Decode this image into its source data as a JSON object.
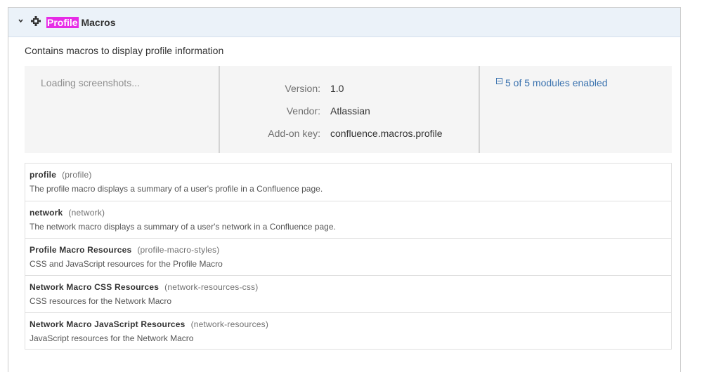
{
  "header": {
    "title_highlight": "Profile",
    "title_rest": " Macros",
    "highlight_color": "#e62be6",
    "background": "#ebf2f9",
    "expand_icon": "chevron-down-icon",
    "plugin_icon": "plugin-puzzle-icon"
  },
  "description": "Contains macros to display profile information",
  "screenshots": {
    "loading_text": "Loading screenshots..."
  },
  "details": {
    "version_label": "Version:",
    "version": "1.0",
    "vendor_label": "Vendor:",
    "vendor": "Atlassian",
    "key_label": "Add-on key:",
    "key": "confluence.macros.profile"
  },
  "modules_summary": {
    "text": "5 of 5 modules enabled",
    "icon": "collapse-minus-icon",
    "link_color": "#3b73af"
  },
  "modules": [
    {
      "name": "profile",
      "key": "(profile)",
      "description": "The profile macro displays a summary of a user's profile in a Confluence page."
    },
    {
      "name": "network",
      "key": "(network)",
      "description": "The network macro displays a summary of a user's network in a Confluence page."
    },
    {
      "name": "Profile Macro Resources",
      "key": "(profile-macro-styles)",
      "description": "CSS and JavaScript resources for the Profile Macro"
    },
    {
      "name": "Network Macro CSS Resources",
      "key": "(network-resources-css)",
      "description": "CSS resources for the Network Macro"
    },
    {
      "name": "Network Macro JavaScript Resources",
      "key": "(network-resources)",
      "description": "JavaScript resources for the Network Macro"
    }
  ]
}
